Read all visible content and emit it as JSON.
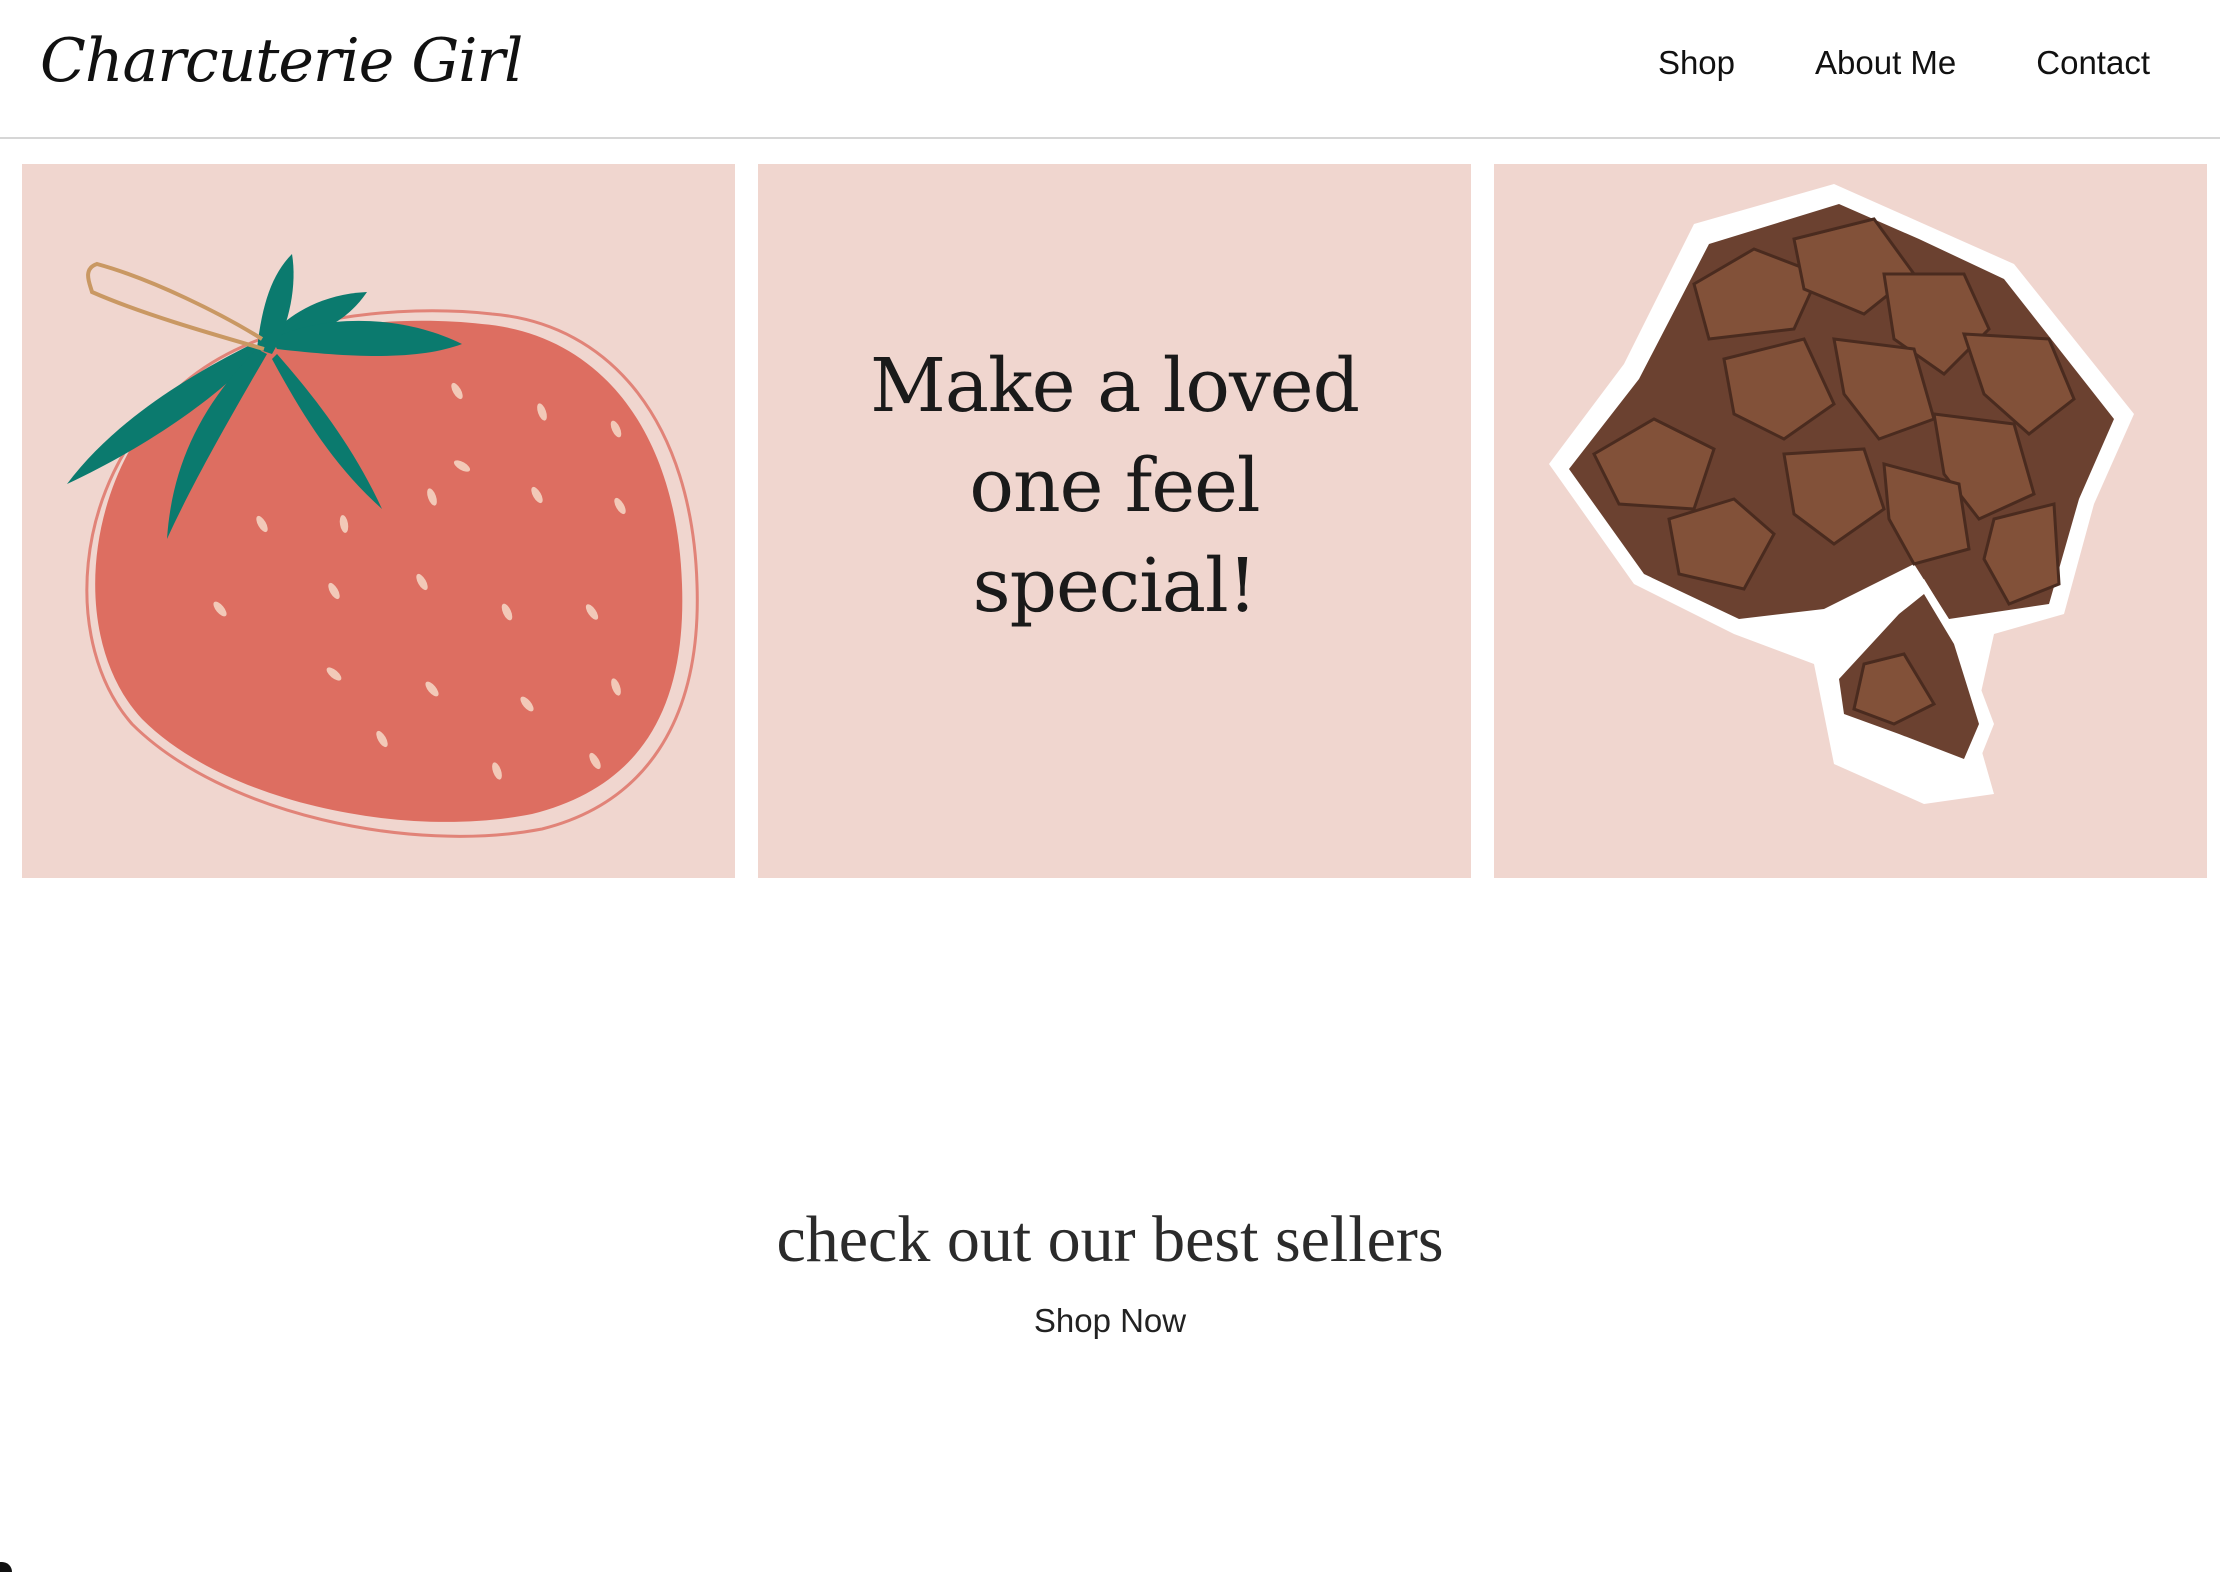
{
  "header": {
    "brand": "Charcuterie Girl",
    "nav": [
      {
        "label": "Shop"
      },
      {
        "label": "About Me"
      },
      {
        "label": "Contact"
      }
    ]
  },
  "hero": {
    "tagline": "Make a loved one feel special!",
    "tile_background": "#f0d6cf",
    "images": [
      {
        "icon": "strawberry-illustration"
      },
      {
        "icon": "chocolate-bar-illustration"
      }
    ]
  },
  "cta": {
    "heading": "check out our best sellers",
    "link": "Shop Now"
  },
  "colors": {
    "strawberry": "#dd6e61",
    "leaf": "#0b7a6e",
    "chocolate": "#6b4130",
    "text": "#1a1a1a"
  }
}
